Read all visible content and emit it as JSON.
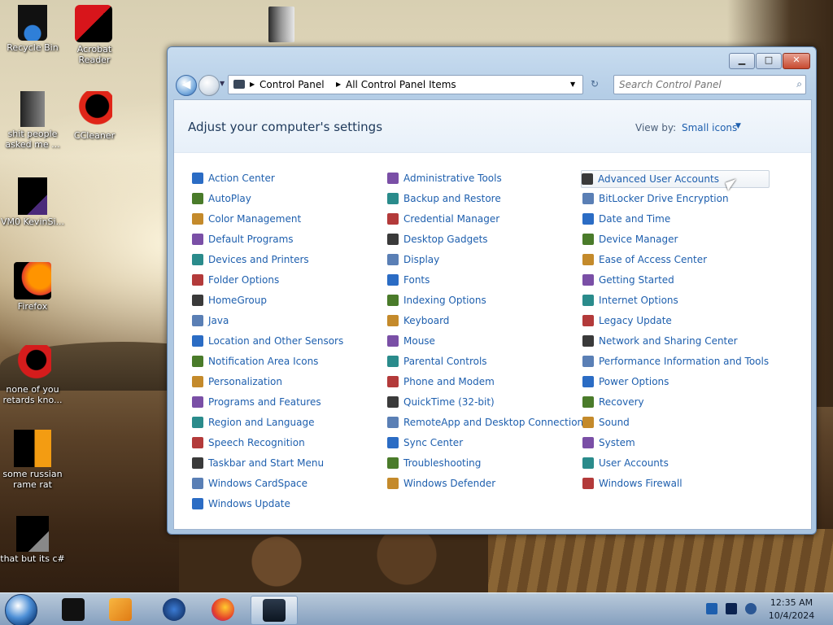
{
  "desktop": {
    "icons": [
      {
        "label": "Recycle Bin",
        "icon": "recycle-bin-icon"
      },
      {
        "label": "Acrobat Reader",
        "icon": "acrobat-reader-icon"
      },
      {
        "label": "shit people asked me ...",
        "icon": "folder-icon"
      },
      {
        "label": "CCleaner",
        "icon": "ccleaner-icon"
      },
      {
        "label": "VM0 KevinSi...",
        "icon": "vm-icon"
      },
      {
        "label": "Firefox",
        "icon": "firefox-icon"
      },
      {
        "label": "none of you retards kno...",
        "icon": "opera-icon"
      },
      {
        "label": "some russian rame rat",
        "icon": "app-icon"
      },
      {
        "label": "that but its c#",
        "icon": "files-icon"
      }
    ]
  },
  "window": {
    "title_buttons": {
      "minimize": "▁",
      "maximize": "□",
      "close": "✕"
    },
    "address": {
      "root": "Control Panel",
      "current": "All Control Panel Items"
    },
    "search_placeholder": "Search Control Panel",
    "header": {
      "title": "Adjust your computer's settings",
      "view_by_label": "View by:",
      "view_by_value": "Small icons"
    },
    "items": {
      "col1": [
        "Action Center",
        "AutoPlay",
        "Color Management",
        "Default Programs",
        "Devices and Printers",
        "Folder Options",
        "HomeGroup",
        "Java",
        "Location and Other Sensors",
        "Notification Area Icons",
        "Personalization",
        "Programs and Features",
        "Region and Language",
        "Speech Recognition",
        "Taskbar and Start Menu",
        "Windows CardSpace",
        "Windows Update"
      ],
      "col2": [
        "Administrative Tools",
        "Backup and Restore",
        "Credential Manager",
        "Desktop Gadgets",
        "Display",
        "Fonts",
        "Indexing Options",
        "Keyboard",
        "Mouse",
        "Parental Controls",
        "Phone and Modem",
        "QuickTime (32-bit)",
        "RemoteApp and Desktop Connections",
        "Sync Center",
        "Troubleshooting",
        "Windows Defender"
      ],
      "col3": [
        "Advanced User Accounts",
        "BitLocker Drive Encryption",
        "Date and Time",
        "Device Manager",
        "Ease of Access Center",
        "Getting Started",
        "Internet Options",
        "Legacy Update",
        "Network and Sharing Center",
        "Performance Information and Tools",
        "Power Options",
        "Recovery",
        "Sound",
        "System",
        "User Accounts",
        "Windows Firewall"
      ]
    }
  },
  "taskbar": {
    "apps": [
      {
        "icon": "terminal-app-icon"
      },
      {
        "icon": "media-player-icon"
      },
      {
        "icon": "globe-icon"
      },
      {
        "icon": "firefox-icon"
      },
      {
        "icon": "control-panel-icon",
        "active": true
      }
    ],
    "clock": {
      "time": "12:35 AM",
      "date": "10/4/2024"
    }
  },
  "colors": {
    "link": "#1e5fae",
    "title": "#1e395b"
  }
}
